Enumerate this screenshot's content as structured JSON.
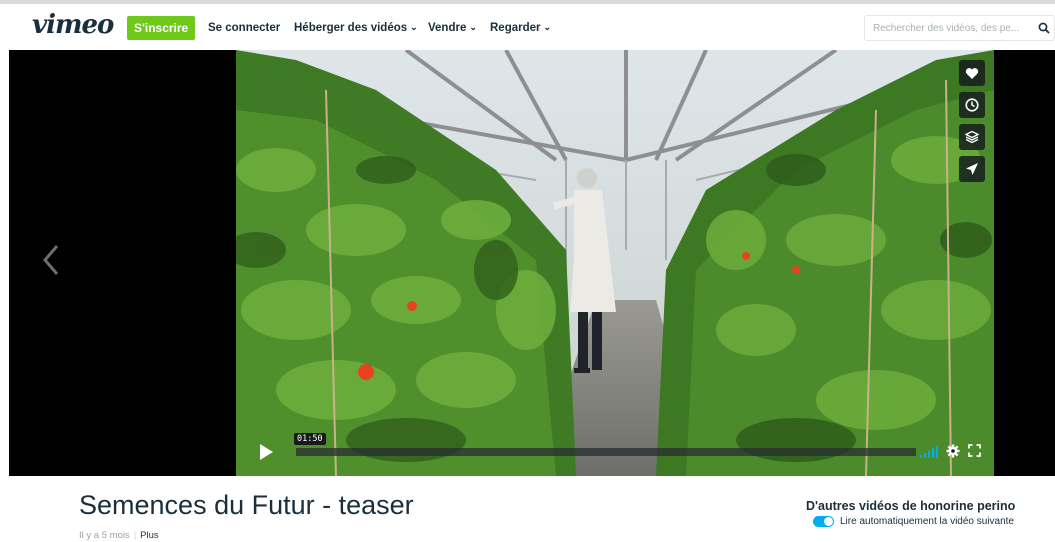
{
  "header": {
    "logo": "vimeo",
    "signup_label": "S'inscrire",
    "login_label": "Se connecter",
    "nav": [
      {
        "label": "Héberger des vidéos"
      },
      {
        "label": "Vendre"
      },
      {
        "label": "Regarder"
      }
    ],
    "search_placeholder": "Rechercher des vidéos, des pe..."
  },
  "player": {
    "timecode": "01:50",
    "side_actions": [
      "heart-icon",
      "clock-icon",
      "layers-icon",
      "send-icon"
    ],
    "progress": 0
  },
  "video": {
    "title": "Semences du Futur - teaser",
    "posted": "Il y a 5 mois",
    "more_label": "Plus"
  },
  "sidebar": {
    "heading": "D'autres vidéos de honorine perino",
    "autoplay_label": "Lire automatiquement la vidéo suivante",
    "autoplay_on": true
  },
  "colors": {
    "accent_green": "#6fc91b",
    "accent_blue": "#00adef",
    "text_dark": "#1a2e3b"
  }
}
